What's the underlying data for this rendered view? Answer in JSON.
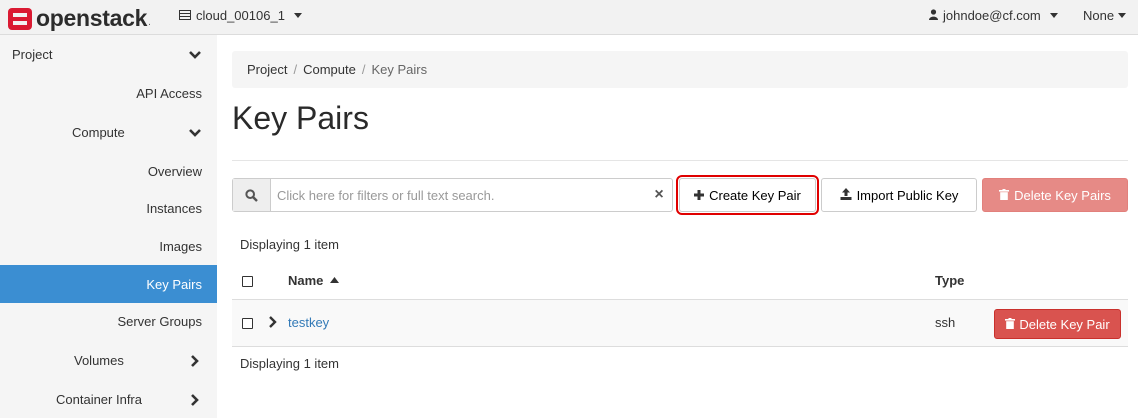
{
  "brand": {
    "name": "openstack",
    "dot": "."
  },
  "topbar": {
    "project": "cloud_00106_1",
    "user": "johndoe@cf.com",
    "region": "None"
  },
  "sidebar": {
    "items": [
      {
        "label": "Project"
      },
      {
        "label": "API Access"
      },
      {
        "label": "Compute"
      },
      {
        "label": "Overview"
      },
      {
        "label": "Instances"
      },
      {
        "label": "Images"
      },
      {
        "label": "Key Pairs"
      },
      {
        "label": "Server Groups"
      },
      {
        "label": "Volumes"
      },
      {
        "label": "Container Infra"
      }
    ],
    "active": "Key Pairs"
  },
  "breadcrumb": {
    "items": [
      "Project",
      "Compute",
      "Key Pairs"
    ]
  },
  "page": {
    "title": "Key Pairs"
  },
  "filter": {
    "placeholder": "Click here for filters or full text search.",
    "value": ""
  },
  "actions": {
    "create": "Create Key Pair",
    "import": "Import Public Key",
    "delete": "Delete Key Pairs"
  },
  "table": {
    "count_top": "Displaying 1 item",
    "count_bottom": "Displaying 1 item",
    "columns": [
      "Name",
      "Type"
    ],
    "sort": {
      "column": "Name",
      "direction": "ascending"
    },
    "rows": [
      {
        "name": "testkey",
        "type": "ssh",
        "action": "Delete Key Pair"
      }
    ]
  },
  "colors": {
    "accent": "#3b8ed2",
    "link": "#337ab7",
    "danger": "#d9534f",
    "danger_disabled": "#e68a86",
    "highlight": "#e00000"
  },
  "icons": {
    "project": "server-icon",
    "user": "user-icon",
    "search": "search-icon",
    "clear": "close-icon",
    "create": "plus-icon",
    "import": "upload-icon",
    "delete": "trash-icon",
    "expand": "chevron-right-icon",
    "sort": "sort-up-icon"
  }
}
